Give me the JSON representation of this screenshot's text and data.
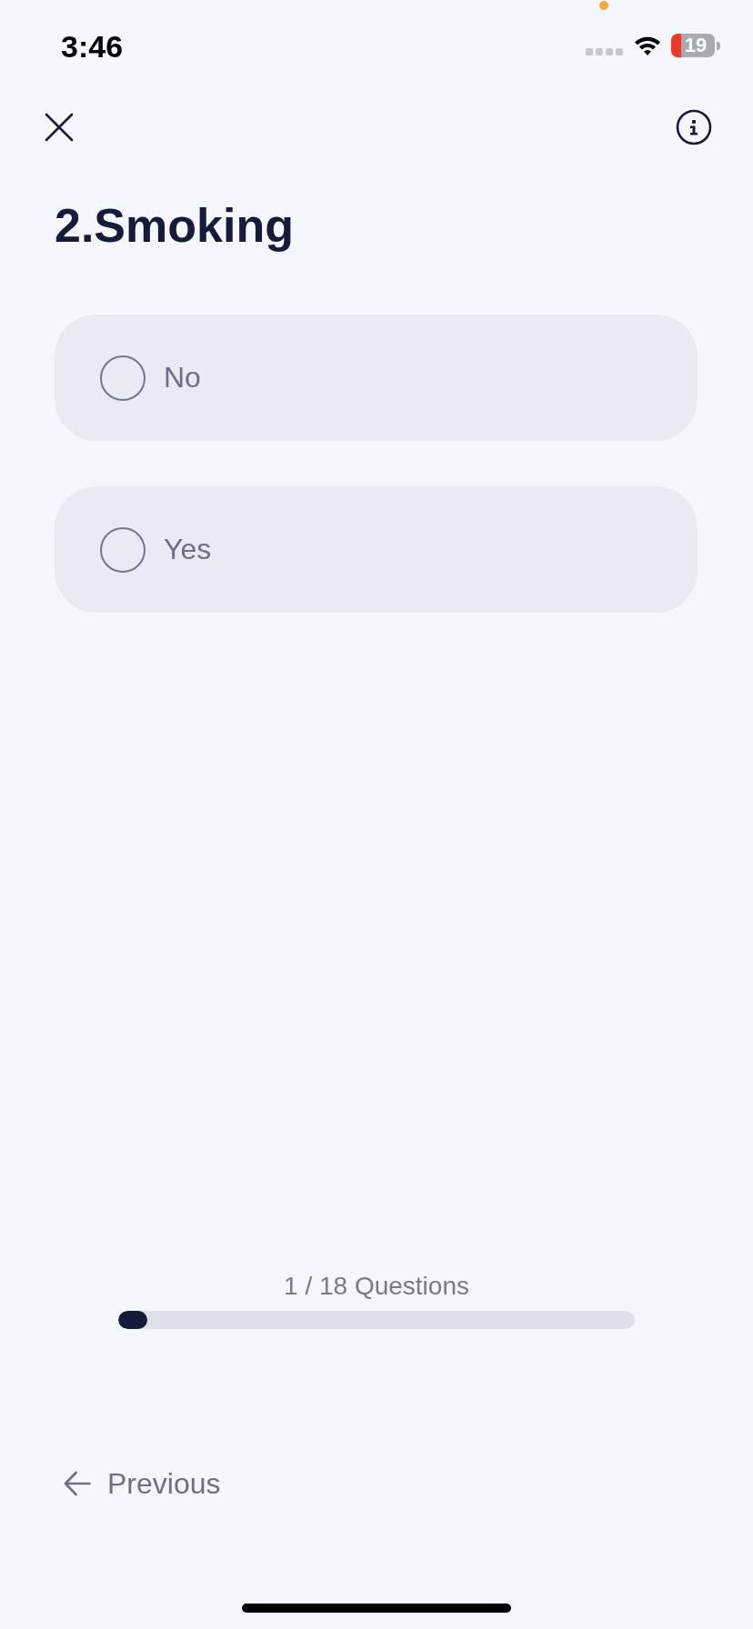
{
  "status_bar": {
    "time": "3:46",
    "battery": "19"
  },
  "question": {
    "title": "2.Smoking",
    "options": [
      {
        "label": "No",
        "selected": false
      },
      {
        "label": "Yes",
        "selected": false
      }
    ]
  },
  "progress": {
    "label": "1 / 18 Questions",
    "level": 0.056
  },
  "navigation": {
    "previous": "Previous"
  }
}
